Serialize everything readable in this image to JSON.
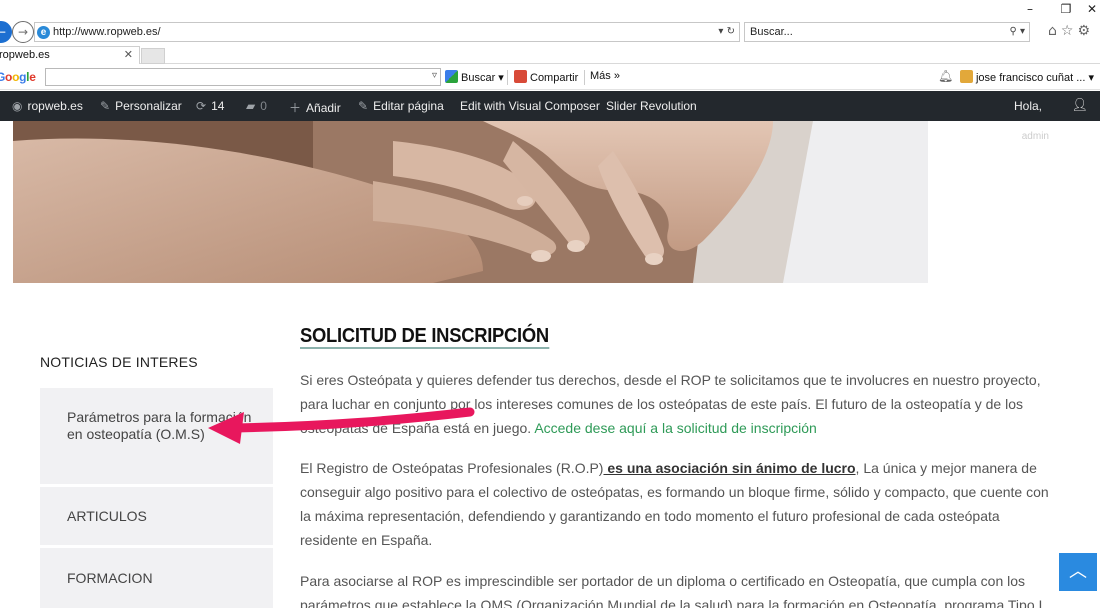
{
  "browser": {
    "url": "http://www.ropweb.es/",
    "search_placeholder": "Buscar...",
    "tab_title": "ropweb.es",
    "icons": [
      "back-icon",
      "forward-icon",
      "ie-logo-icon",
      "refresh-icon",
      "search-icon",
      "home-icon",
      "favorites-icon",
      "settings-icon"
    ]
  },
  "google_toolbar": {
    "logo": {
      "b1": "G",
      "r1": "o",
      "y": "o",
      "b2": "g",
      "g": "l",
      "r2": "e"
    },
    "buscar": "Buscar",
    "compartir": "Compartir",
    "mas": "Más »",
    "user": "jose francisco cuñat ..."
  },
  "admin_bar": {
    "site": "ropweb.es",
    "personalizar": "Personalizar",
    "updates": "14",
    "comments": "0",
    "anadir": "Añadir",
    "editar": "Editar página",
    "vc": "Edit with Visual Composer",
    "slider": "Slider Revolution",
    "hola": "Hola,",
    "admin": "admin"
  },
  "sidebar": {
    "title": "NOTICIAS DE INTERES",
    "items": [
      {
        "label": "Parámetros para la formación en osteopatía (O.M.S)"
      },
      {
        "label": "ARTICULOS"
      },
      {
        "label": "FORMACION"
      }
    ]
  },
  "main": {
    "title": "SOLICITUD DE INSCRIPCIÓN",
    "p1_text": "Si eres Osteópata y quieres defender tus derechos, desde el ROP te solicitamos que te involucres en nuestro proyecto, para luchar en conjunto por los intereses comunes de los osteópatas de este país. El futuro de la osteopatía y de los osteópatas de España está en juego.",
    "p1_link": "Accede dese aquí a la solicitud de inscripción",
    "p2_a": "El Registro de Osteópatas Profesionales (R.O.P)",
    "p2_b": " es una asociación sin ánimo de lucro",
    "p2_c": ", La única y mejor manera de conseguir algo positivo para el colectivo de osteópatas, es formando un bloque firme, sólido y compacto, que cuente con la máxima representación, defendiendo y garantizando en todo momento el futuro profesional de cada osteópata residente en España.",
    "p3": "Para asociarse al ROP es imprescindible ser portador de un diploma o certificado en Osteopatía, que cumpla con los parámetros que establece la OMS (Organización Mundial de la salud) para la formación en Osteopatía, programa Tipo I"
  },
  "colors": {
    "admin_bar": "#23282d",
    "link_green": "#2e9a57",
    "annotation_arrow": "#e8175d",
    "to_top_button": "#2a8ae0",
    "sidebar_bg": "#f1f1f3"
  }
}
